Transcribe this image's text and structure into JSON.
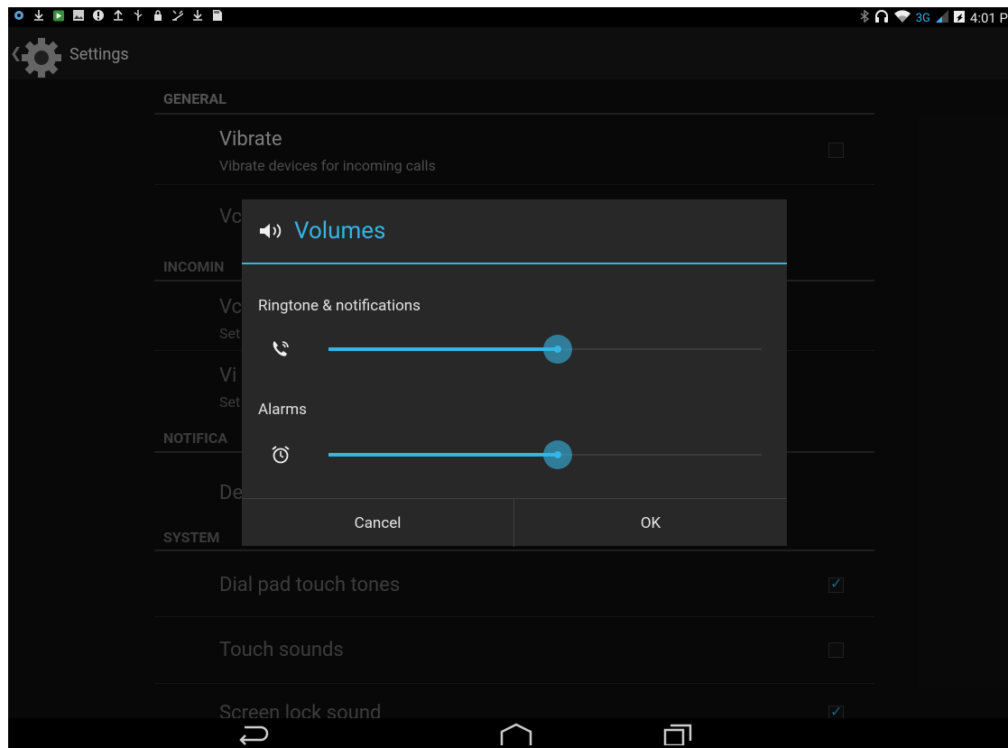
{
  "status_bar": {
    "left_icons": [
      "sync-icon",
      "download-icon",
      "play-store-icon",
      "image-icon",
      "alert-icon",
      "upload-icon",
      "usb-icon",
      "lock-icon",
      "debug-icon",
      "download-icon",
      "sd-card-icon"
    ],
    "network_label": "3G",
    "time": "4:01 P"
  },
  "action_bar": {
    "title": "Settings"
  },
  "settings": {
    "sections": {
      "general": "GENERAL",
      "incoming": "INCOMIN",
      "notifications": "NOTIFICA",
      "system": "SYSTEM"
    },
    "items": {
      "vibrate_title": "Vibrate",
      "vibrate_sub": "Vibrate devices for incoming calls",
      "volumes_partial": "Vc",
      "voice_partial": "Vc",
      "voice_sub_partial": "Set",
      "video_partial": "Vi",
      "video_sub_partial": "Set",
      "default_partial": "De",
      "dial_pad": "Dial pad touch tones",
      "touch_sounds": "Touch sounds",
      "screen_lock": "Screen lock sound"
    },
    "checked": {
      "vibrate": false,
      "dial_pad": true,
      "touch_sounds": false,
      "screen_lock": true
    }
  },
  "dialog": {
    "title": "Volumes",
    "ringtone_label": "Ringtone & notifications",
    "ringtone_level": 0.53,
    "alarms_label": "Alarms",
    "alarms_level": 0.53,
    "cancel": "Cancel",
    "ok": "OK"
  },
  "colors": {
    "accent": "#33b5e5",
    "background": "#101010",
    "dialog": "#282828"
  }
}
